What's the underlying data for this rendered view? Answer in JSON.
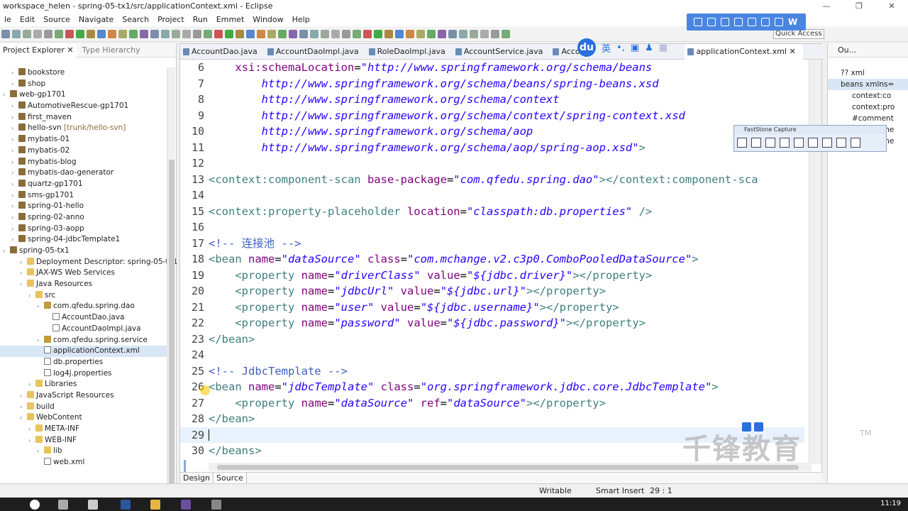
{
  "window": {
    "title": "workspace_helen - spring-05-tx1/src/applicationContext.xml - Eclipse",
    "ctrl_min": "—",
    "ctrl_max": "❐",
    "ctrl_close": "✕"
  },
  "menu": [
    "le",
    "Edit",
    "Source",
    "Navigate",
    "Search",
    "Project",
    "Run",
    "Emmet",
    "Window",
    "Help"
  ],
  "quick_access": "Quick Access",
  "left_panel": {
    "tab_explorer": "Project Explorer ✕",
    "tab_hierarchy": "Type Hierarchy",
    "tree": [
      {
        "label": "bookstore",
        "extra": ""
      },
      {
        "label": "shop",
        "extra": ""
      },
      {
        "label": "web-gp1701",
        "extra": ""
      },
      {
        "label": "AutomotiveRescue-gp1701",
        "extra": ""
      },
      {
        "label": "first_maven",
        "extra": ""
      },
      {
        "label": "hello-svn",
        "extra": " [trunk/hello-svn]"
      },
      {
        "label": "mybatis-01",
        "extra": ""
      },
      {
        "label": "mybatis-02",
        "extra": ""
      },
      {
        "label": "mybatis-blog",
        "extra": ""
      },
      {
        "label": "mybatis-dao-generator",
        "extra": ""
      },
      {
        "label": "quartz-gp1701",
        "extra": ""
      },
      {
        "label": "sms-gp1701",
        "extra": ""
      },
      {
        "label": "spring-01-hello",
        "extra": ""
      },
      {
        "label": "spring-02-anno",
        "extra": ""
      },
      {
        "label": "spring-03-aopp",
        "extra": ""
      },
      {
        "label": "spring-04-jdbcTemplate1",
        "extra": ""
      },
      {
        "label": "spring-05-tx1",
        "extra": ""
      },
      {
        "label": "Deployment Descriptor: spring-05-tx1",
        "extra": ""
      },
      {
        "label": "JAX-WS Web Services",
        "extra": ""
      },
      {
        "label": "Java Resources",
        "extra": ""
      },
      {
        "label": "src",
        "extra": ""
      },
      {
        "label": "com.qfedu.spring.dao",
        "extra": ""
      },
      {
        "label": "AccountDao.java",
        "extra": ""
      },
      {
        "label": "AccountDaoImpl.java",
        "extra": ""
      },
      {
        "label": "com.qfedu.spring.service",
        "extra": ""
      },
      {
        "label": "applicationContext.xml",
        "extra": ""
      },
      {
        "label": "db.properties",
        "extra": ""
      },
      {
        "label": "log4j.properties",
        "extra": ""
      },
      {
        "label": "Libraries",
        "extra": ""
      },
      {
        "label": "JavaScript Resources",
        "extra": ""
      },
      {
        "label": "build",
        "extra": ""
      },
      {
        "label": "WebContent",
        "extra": ""
      },
      {
        "label": "META-INF",
        "extra": ""
      },
      {
        "label": "WEB-INF",
        "extra": ""
      },
      {
        "label": "lib",
        "extra": ""
      },
      {
        "label": "web.xml",
        "extra": ""
      }
    ]
  },
  "editor": {
    "tabs": [
      "AccountDao.java",
      "AccountDaoImpl.java",
      "RoleDaoImpl.java",
      "AccountService.java",
      "Accou",
      "applicationContext.xml ✕"
    ],
    "lines": [
      {
        "n": "6",
        "parts": [
          {
            "c": "attr",
            "t": "    xsi:schemaLocation"
          },
          {
            "c": "txt",
            "t": "="
          },
          {
            "c": "val",
            "t": "\"http://www.springframework.org/schema/beans"
          }
        ]
      },
      {
        "n": "7",
        "parts": [
          {
            "c": "val",
            "t": "        http://www.springframework.org/schema/beans/spring-beans.xsd"
          }
        ]
      },
      {
        "n": "8",
        "parts": [
          {
            "c": "val",
            "t": "        http://www.springframework.org/schema/context"
          }
        ]
      },
      {
        "n": "9",
        "parts": [
          {
            "c": "val",
            "t": "        http://www.springframework.org/schema/context/spring-context.xsd"
          }
        ]
      },
      {
        "n": "10",
        "parts": [
          {
            "c": "val",
            "t": "        http://www.springframework.org/schema/aop"
          }
        ]
      },
      {
        "n": "11",
        "parts": [
          {
            "c": "val",
            "t": "        http://www.springframework.org/schema/aop/spring-aop.xsd\""
          },
          {
            "c": "tag",
            "t": ">"
          }
        ]
      },
      {
        "n": "12",
        "parts": []
      },
      {
        "n": "13",
        "parts": [
          {
            "c": "tag",
            "t": "<context:component-scan "
          },
          {
            "c": "attr",
            "t": "base-package"
          },
          {
            "c": "txt",
            "t": "="
          },
          {
            "c": "val",
            "t": "\"com.qfedu.spring.dao\""
          },
          {
            "c": "tag",
            "t": "></context:component-sca"
          }
        ]
      },
      {
        "n": "14",
        "parts": []
      },
      {
        "n": "15",
        "parts": [
          {
            "c": "tag",
            "t": "<context:property-placeholder "
          },
          {
            "c": "attr",
            "t": "location"
          },
          {
            "c": "txt",
            "t": "="
          },
          {
            "c": "val",
            "t": "\"classpath:db.properties\""
          },
          {
            "c": "tag",
            "t": " />"
          }
        ]
      },
      {
        "n": "16",
        "parts": []
      },
      {
        "n": "17",
        "parts": [
          {
            "c": "cmt",
            "t": "<!-- 连接池 -->"
          }
        ]
      },
      {
        "n": "18",
        "parts": [
          {
            "c": "tag",
            "t": "<bean "
          },
          {
            "c": "attr",
            "t": "name"
          },
          {
            "c": "txt",
            "t": "="
          },
          {
            "c": "val",
            "t": "\"dataSource\""
          },
          {
            "c": "txt",
            "t": " "
          },
          {
            "c": "attr",
            "t": "class"
          },
          {
            "c": "txt",
            "t": "="
          },
          {
            "c": "val",
            "t": "\"com.mchange.v2.c3p0.ComboPooledDataSource\""
          },
          {
            "c": "tag",
            "t": ">"
          }
        ]
      },
      {
        "n": "19",
        "parts": [
          {
            "c": "tag",
            "t": "    <property "
          },
          {
            "c": "attr",
            "t": "name"
          },
          {
            "c": "txt",
            "t": "="
          },
          {
            "c": "val",
            "t": "\"driverClass\""
          },
          {
            "c": "txt",
            "t": " "
          },
          {
            "c": "attr",
            "t": "value"
          },
          {
            "c": "txt",
            "t": "="
          },
          {
            "c": "val",
            "t": "\"${jdbc.driver}\""
          },
          {
            "c": "tag",
            "t": "></property>"
          }
        ]
      },
      {
        "n": "20",
        "parts": [
          {
            "c": "tag",
            "t": "    <property "
          },
          {
            "c": "attr",
            "t": "name"
          },
          {
            "c": "txt",
            "t": "="
          },
          {
            "c": "val",
            "t": "\"jdbcUrl\""
          },
          {
            "c": "txt",
            "t": " "
          },
          {
            "c": "attr",
            "t": "value"
          },
          {
            "c": "txt",
            "t": "="
          },
          {
            "c": "val",
            "t": "\"${jdbc.url}\""
          },
          {
            "c": "tag",
            "t": "></property>"
          }
        ]
      },
      {
        "n": "21",
        "parts": [
          {
            "c": "tag",
            "t": "    <property "
          },
          {
            "c": "attr",
            "t": "name"
          },
          {
            "c": "txt",
            "t": "="
          },
          {
            "c": "val",
            "t": "\"user\""
          },
          {
            "c": "txt",
            "t": " "
          },
          {
            "c": "attr",
            "t": "value"
          },
          {
            "c": "txt",
            "t": "="
          },
          {
            "c": "val",
            "t": "\"${jdbc.username}\""
          },
          {
            "c": "tag",
            "t": "></property>"
          }
        ]
      },
      {
        "n": "22",
        "parts": [
          {
            "c": "tag",
            "t": "    <property "
          },
          {
            "c": "attr",
            "t": "name"
          },
          {
            "c": "txt",
            "t": "="
          },
          {
            "c": "val",
            "t": "\"password\""
          },
          {
            "c": "txt",
            "t": " "
          },
          {
            "c": "attr",
            "t": "value"
          },
          {
            "c": "txt",
            "t": "="
          },
          {
            "c": "val",
            "t": "\"${jdbc.password}\""
          },
          {
            "c": "tag",
            "t": "></property>"
          }
        ]
      },
      {
        "n": "23",
        "parts": [
          {
            "c": "tag",
            "t": "</bean>"
          }
        ]
      },
      {
        "n": "24",
        "parts": []
      },
      {
        "n": "25",
        "parts": [
          {
            "c": "cmt",
            "t": "<!-- JdbcTemplate -->"
          }
        ]
      },
      {
        "n": "26",
        "parts": [
          {
            "c": "tag",
            "t": "<bean "
          },
          {
            "c": "attr",
            "t": "name"
          },
          {
            "c": "txt",
            "t": "="
          },
          {
            "c": "val",
            "t": "\"jdbcTemplate\""
          },
          {
            "c": "txt",
            "t": " "
          },
          {
            "c": "attr",
            "t": "class"
          },
          {
            "c": "txt",
            "t": "="
          },
          {
            "c": "val",
            "t": "\"org.springframework.jdbc.core.JdbcTemplate\""
          },
          {
            "c": "tag",
            "t": ">"
          }
        ]
      },
      {
        "n": "27",
        "parts": [
          {
            "c": "tag",
            "t": "    <property "
          },
          {
            "c": "attr",
            "t": "name"
          },
          {
            "c": "txt",
            "t": "="
          },
          {
            "c": "val",
            "t": "\"dataSource\""
          },
          {
            "c": "txt",
            "t": " "
          },
          {
            "c": "attr",
            "t": "ref"
          },
          {
            "c": "txt",
            "t": "="
          },
          {
            "c": "val",
            "t": "\"dataSource\""
          },
          {
            "c": "tag",
            "t": "></property>"
          }
        ]
      },
      {
        "n": "28",
        "parts": [
          {
            "c": "tag",
            "t": "</bean>"
          }
        ]
      },
      {
        "n": "29",
        "parts": []
      },
      {
        "n": "30",
        "parts": [
          {
            "c": "tag",
            "t": "</beans>"
          }
        ]
      }
    ],
    "bottom_tab_design": "Design",
    "bottom_tab_source": "Source"
  },
  "outline": {
    "tab": "Ou...",
    "rows": [
      "?? xml",
      "beans xmlns=",
      "context:co",
      "context:pro",
      "#comment",
      "bean name",
      "bean name"
    ]
  },
  "ime": {
    "logo": "du",
    "lang": "英"
  },
  "fastcapture_title": "FastStone Capture",
  "watermark": "千锋教育",
  "watermark_tm": "TM",
  "status": {
    "writable": "Writable",
    "insert": "Smart Insert",
    "pos": "29 : 1"
  },
  "clock": "11:19",
  "colors": {
    "accent": "#4a86e0",
    "tag": "#3f7f7f",
    "attr": "#7f007f",
    "value": "#2a00ff",
    "comment": "#3f5fbf"
  }
}
